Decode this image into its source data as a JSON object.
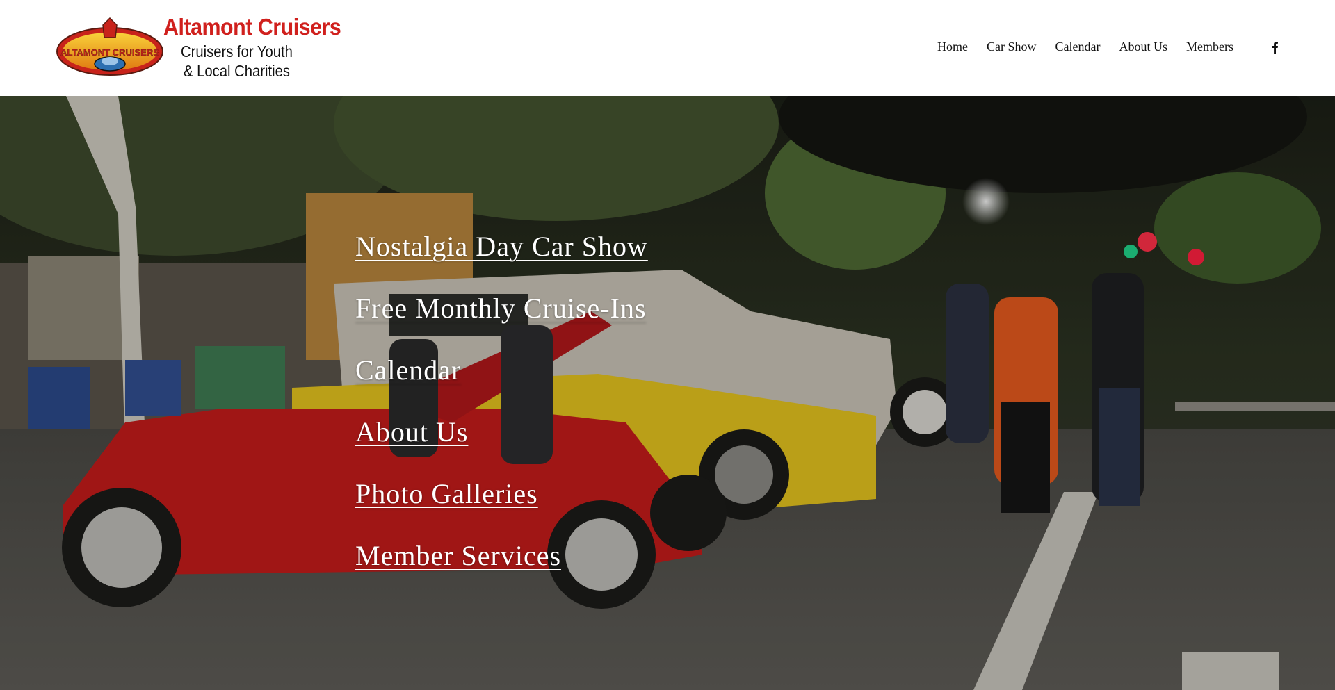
{
  "header": {
    "brand_title": "Altamont Cruisers",
    "tagline_line1": "Cruisers for Youth",
    "tagline_line2": "& Local Charities",
    "logo_icon": "altamont-cruisers-logo"
  },
  "nav": {
    "items": [
      {
        "label": "Home"
      },
      {
        "label": "Car Show"
      },
      {
        "label": "Calendar"
      },
      {
        "label": "About Us"
      },
      {
        "label": "Members"
      }
    ],
    "social_icon": "facebook-icon"
  },
  "hero": {
    "links": [
      {
        "label": "Nostalgia Day Car Show"
      },
      {
        "label": "Free Monthly Cruise-Ins"
      },
      {
        "label": "Calendar"
      },
      {
        "label": "About Us"
      },
      {
        "label": "Photo Galleries"
      },
      {
        "label": "Member Services"
      }
    ]
  },
  "colors": {
    "brand_red": "#d0201d",
    "text_dark": "#111111",
    "hero_link": "#ffffff"
  }
}
